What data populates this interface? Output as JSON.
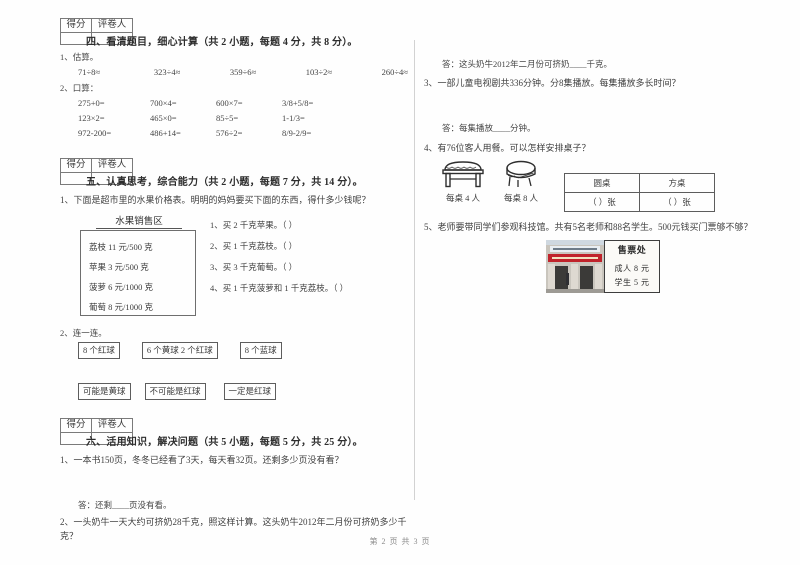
{
  "score_box": {
    "score_label": "得分",
    "grader_label": "评卷人"
  },
  "section4": {
    "title": "四、看清题目，细心计算（共 2 小题，每题 4 分，共 8 分）。",
    "q1_label": "1、估算。",
    "estimate": [
      "71÷8≈",
      "323÷4≈",
      "359÷6≈",
      "103÷2≈",
      "260÷4≈"
    ],
    "q2_label": "2、口算：",
    "mental": [
      [
        "275+0=",
        "700×4=",
        "600×7=",
        "3/8+5/8="
      ],
      [
        "123×2=",
        "465×0=",
        "85÷5=",
        "1-1/3="
      ],
      [
        "972-200=",
        "486+14=",
        "576÷2=",
        "8/9-2/9="
      ]
    ]
  },
  "section5": {
    "title": "五、认真思考，综合能力（共 2 小题，每题 7 分，共 14 分）。",
    "q1": "1、下面是超市里的水果价格表。明明的妈妈要买下面的东西，得什多少钱呢？",
    "fruit_title": "水果销售区",
    "fruit_items": [
      "荔枝 11 元/500 克",
      "苹果 3 元/500 克",
      "菠萝 6 元/1000 克",
      "葡萄 8 元/1000 克"
    ],
    "fruit_questions": [
      "1、买 2 千克苹果。（        ）",
      "2、买 1 千克荔枝。（        ）",
      "3、买 3 千克葡萄。（        ）",
      "4、买 1 千克菠萝和 1 千克荔枝。（     ）"
    ],
    "q2": "2、连一连。",
    "match_top": [
      "8 个红球",
      "6 个黄球 2 个红球",
      "8 个蓝球"
    ],
    "match_bottom": [
      "可能是黄球",
      "不可能是红球",
      "一定是红球"
    ]
  },
  "section6": {
    "title": "六、活用知识，解决问题（共 5 小题，每题 5 分，共 25 分）。",
    "q1": "1、一本书150页，冬冬已经看了3天，每天看32页。还剩多少页没有看？",
    "a1": "答：还剩____页没有看。",
    "q2": "2、一头奶牛一天大约可挤奶28千克，照这样计算。这头奶牛2012年二月份可挤奶多少千克？",
    "a2": "答：这头奶牛2012年二月份可挤奶____千克。",
    "q3": "3、一部儿童电视剧共336分钟。分8集播放。每集播放多长时间？",
    "a3": "答：每集播放____分钟。",
    "q4": "4、有76位客人用餐。可以怎样安排桌子？",
    "furniture": [
      {
        "icon": "rectangular-table-icon",
        "label": "每桌 4 人"
      },
      {
        "icon": "round-table-icon",
        "label": "每桌 8 人"
      }
    ],
    "seat_table": {
      "headers": [
        "圆桌",
        "方桌"
      ],
      "cells": [
        "（     ）张",
        "（     ）张"
      ]
    },
    "q5": "5、老师要带同学们参观科技馆。共有5名老师和88名学生。500元钱买门票够不够？",
    "ticket_sign": {
      "title": "售票处",
      "lines": [
        "成人 8 元",
        "学生 5 元"
      ]
    }
  },
  "footer": "第 2 页 共 3 页"
}
